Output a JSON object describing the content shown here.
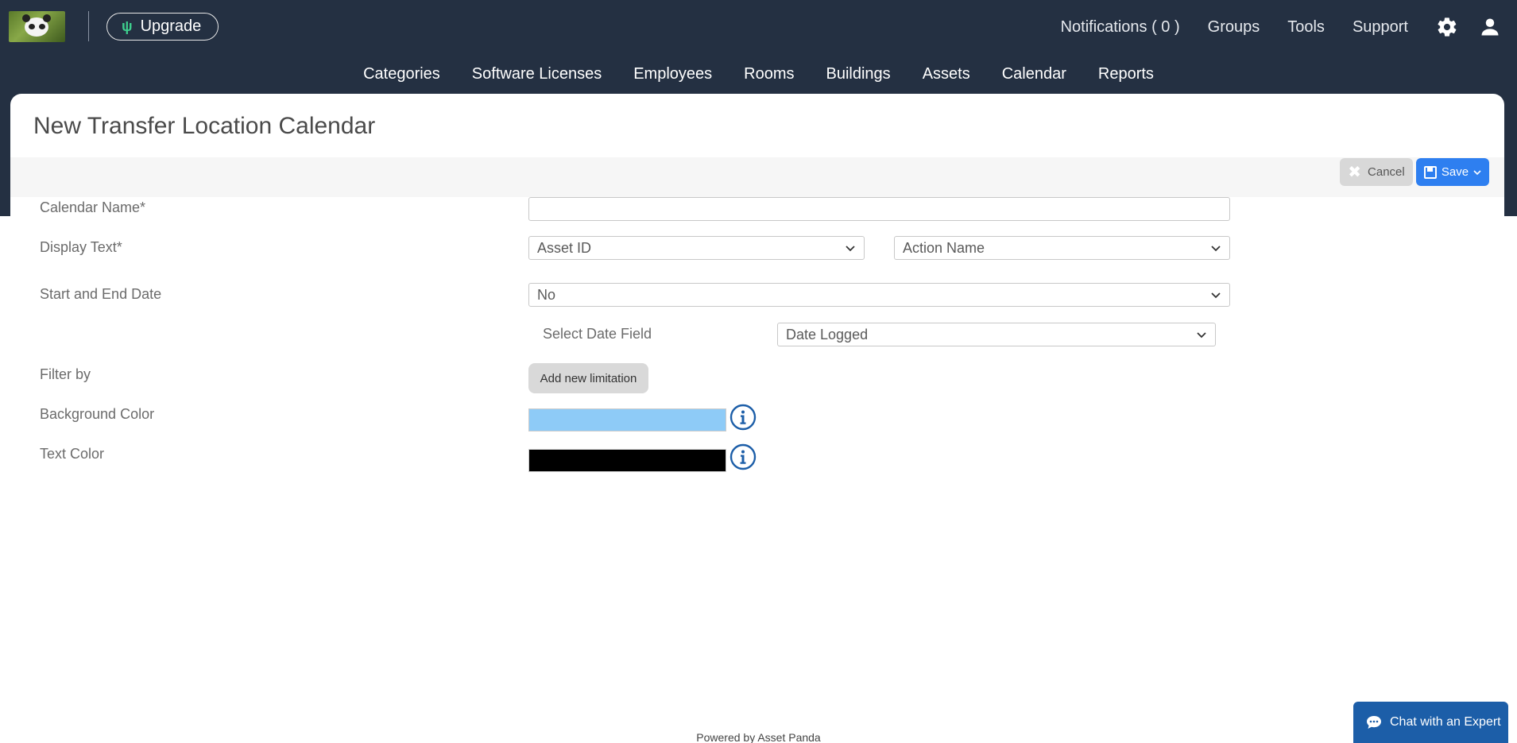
{
  "header": {
    "upgrade_label": "Upgrade",
    "top_links": [
      "Notifications ( 0 )",
      "Groups",
      "Tools",
      "Support"
    ],
    "icons": [
      "gear-icon",
      "user-icon"
    ]
  },
  "main_nav": [
    "Categories",
    "Software Licenses",
    "Employees",
    "Rooms",
    "Buildings",
    "Assets",
    "Calendar",
    "Reports"
  ],
  "page": {
    "title": "New Transfer Location Calendar"
  },
  "toolbar": {
    "cancel_label": "Cancel",
    "save_label": "Save"
  },
  "form": {
    "calendar_name_label": "Calendar Name*",
    "calendar_name_value": "",
    "display_text_label": "Display Text*",
    "display_text_select_1": "Asset ID",
    "display_text_select_2": "Action Name",
    "start_end_label": "Start and End Date",
    "start_end_value": "No",
    "date_field_label": "Select Date Field",
    "date_field_value": "Date Logged",
    "filter_label": "Filter by",
    "add_limitation_label": "Add new limitation",
    "background_color_label": "Background Color",
    "background_color_value": "#8ecbf7",
    "text_color_label": "Text Color",
    "text_color_value": "#000000"
  },
  "chat": {
    "label": "Chat with an Expert"
  },
  "footer": {
    "powered_by": "Powered by Asset Panda"
  },
  "colors": {
    "header_bg": "#243042",
    "primary": "#2e7ff0",
    "chat_bg": "#1c5ea8"
  }
}
